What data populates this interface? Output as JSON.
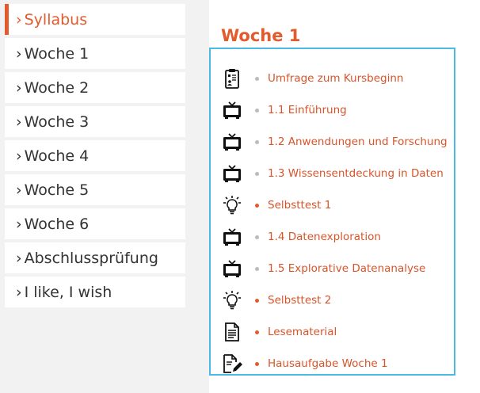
{
  "sidebar": {
    "items": [
      {
        "label": "Syllabus",
        "active": true
      },
      {
        "label": "Woche 1"
      },
      {
        "label": "Woche 2"
      },
      {
        "label": "Woche 3"
      },
      {
        "label": "Woche 4"
      },
      {
        "label": "Woche 5"
      },
      {
        "label": "Woche 6"
      },
      {
        "label": "Abschlussprüfung"
      },
      {
        "label": "I like, I wish"
      }
    ]
  },
  "main": {
    "title": "Woche 1",
    "items": [
      {
        "icon": "survey-clipboard-icon",
        "bullet": "grey",
        "label": "Umfrage zum Kursbeginn"
      },
      {
        "icon": "video-tv-icon",
        "bullet": "grey",
        "label": "1.1 Einführung"
      },
      {
        "icon": "video-tv-icon",
        "bullet": "grey",
        "label": "1.2 Anwendungen und Forschung"
      },
      {
        "icon": "video-tv-icon",
        "bullet": "grey",
        "label": "1.3 Wissensentdeckung in Daten"
      },
      {
        "icon": "lightbulb-icon",
        "bullet": "red",
        "label": "Selbsttest 1"
      },
      {
        "icon": "video-tv-icon",
        "bullet": "grey",
        "label": "1.4 Datenexploration"
      },
      {
        "icon": "video-tv-icon",
        "bullet": "grey",
        "label": "1.5 Explorative Datenanalyse"
      },
      {
        "icon": "lightbulb-icon",
        "bullet": "red",
        "label": "Selbsttest 2"
      },
      {
        "icon": "document-icon",
        "bullet": "red",
        "label": "Lesematerial"
      },
      {
        "icon": "assignment-edit-icon",
        "bullet": "red",
        "label": "Hausaufgabe Woche 1"
      }
    ]
  },
  "colors": {
    "accent": "#e35a2c",
    "box_border": "#4bb9e4",
    "sidebar_bg": "#f2f2f2",
    "bullet_grey": "#bbbbbb"
  }
}
